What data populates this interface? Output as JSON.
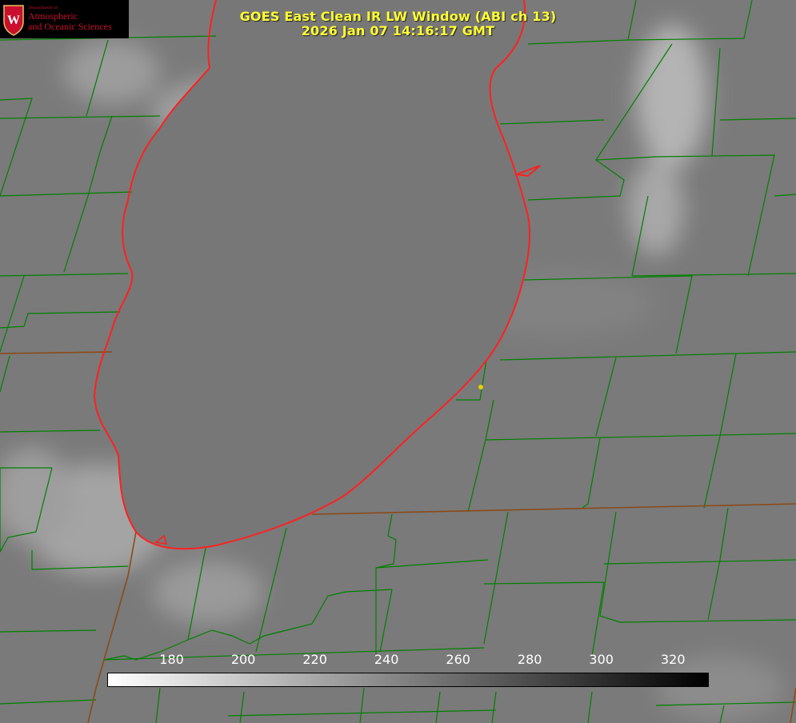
{
  "title": {
    "line1": "GOES East Clean IR LW Window (ABI ch 13)",
    "line2": "2026 Jan 07 14:16:17 GMT"
  },
  "logo": {
    "dept": "Department of",
    "line1": "Atmospheric",
    "line2": "and Oceanic Sciences",
    "seal_letter": "W"
  },
  "colorbar": {
    "range": [
      162,
      330
    ],
    "ticks": [
      "180",
      "200",
      "220",
      "240",
      "260",
      "280",
      "300",
      "320"
    ],
    "tick_values": [
      180,
      200,
      220,
      240,
      260,
      280,
      300,
      320
    ]
  },
  "colors": {
    "title_text": "#ffff33",
    "county_lines": "#008000",
    "state_lines": "#b05020",
    "shoreline": "#ff2020",
    "marker": "#e6d000"
  }
}
